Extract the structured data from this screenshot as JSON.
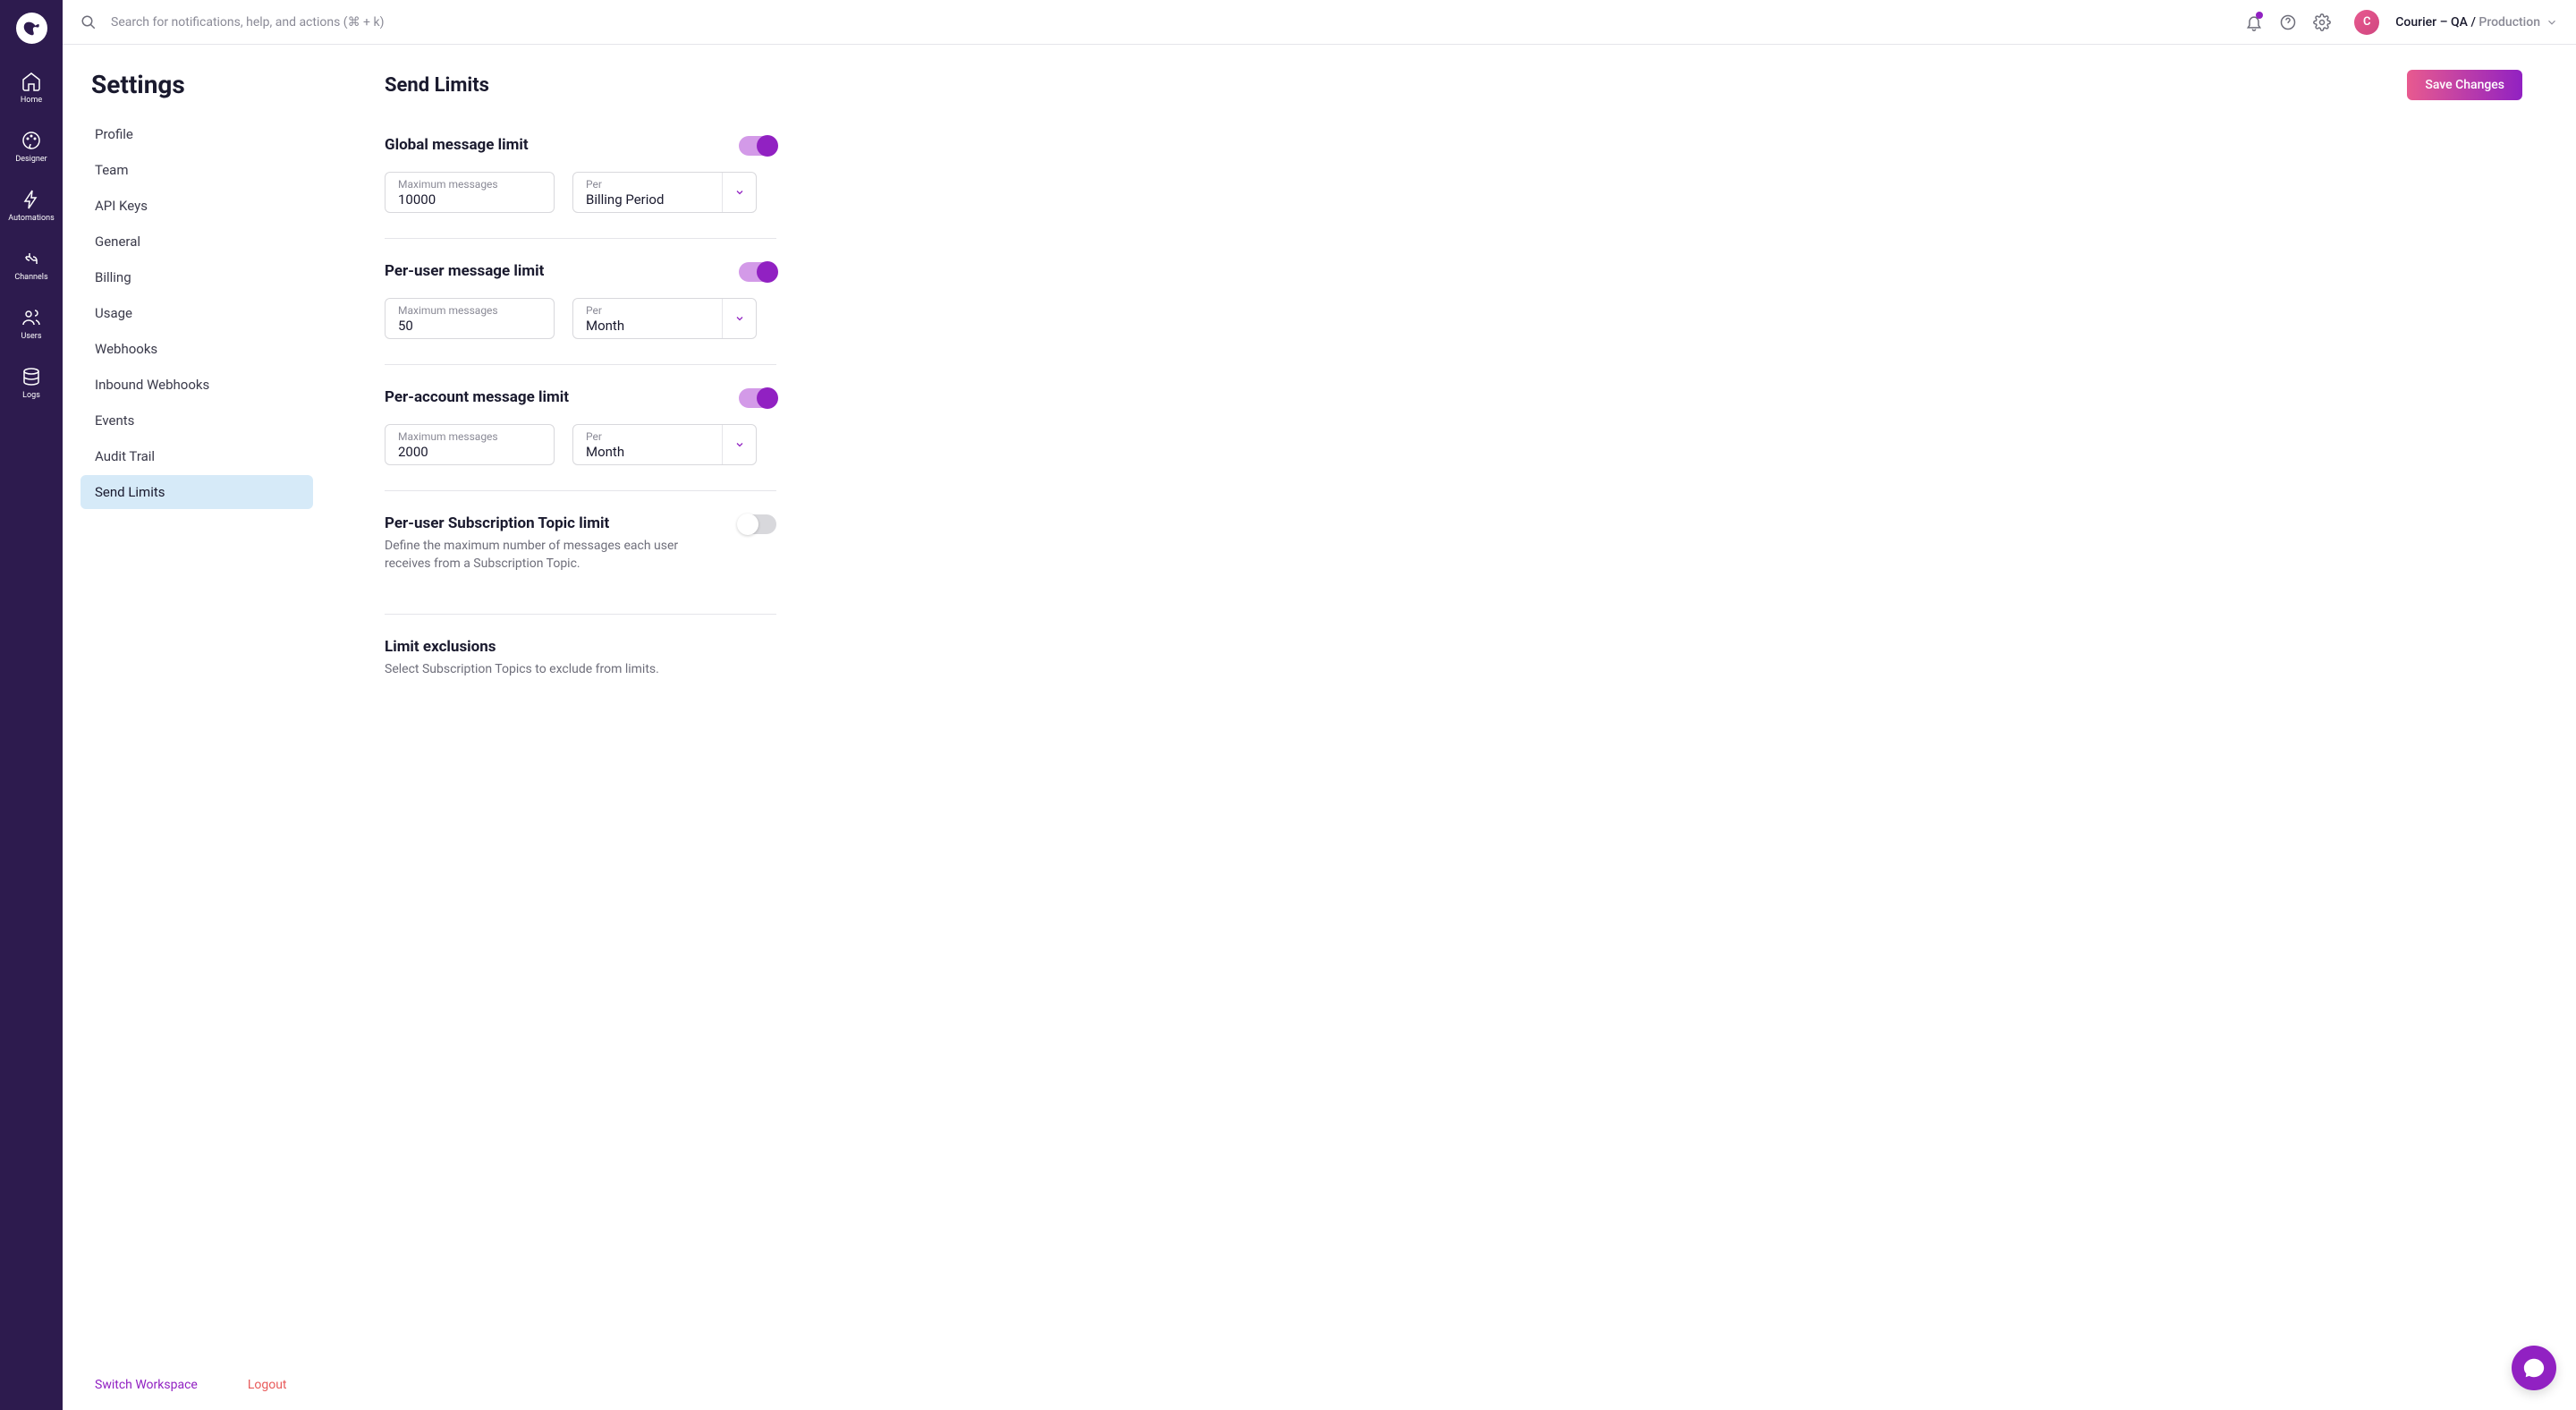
{
  "nav": {
    "items": [
      {
        "label": "Home"
      },
      {
        "label": "Designer"
      },
      {
        "label": "Automations"
      },
      {
        "label": "Channels"
      },
      {
        "label": "Users"
      },
      {
        "label": "Logs"
      }
    ]
  },
  "header": {
    "search_placeholder": "Search for notifications, help, and actions (⌘ + k)",
    "avatar_initial": "C",
    "workspace_primary": "Courier – QA / ",
    "workspace_secondary": "Production"
  },
  "settings": {
    "title": "Settings",
    "nav": [
      {
        "label": "Profile"
      },
      {
        "label": "Team"
      },
      {
        "label": "API Keys"
      },
      {
        "label": "General"
      },
      {
        "label": "Billing"
      },
      {
        "label": "Usage"
      },
      {
        "label": "Webhooks"
      },
      {
        "label": "Inbound Webhooks"
      },
      {
        "label": "Events"
      },
      {
        "label": "Audit Trail"
      },
      {
        "label": "Send Limits"
      }
    ],
    "active_index": 10,
    "footer": {
      "switch": "Switch Workspace",
      "logout": "Logout"
    }
  },
  "page": {
    "heading": "Send Limits",
    "save_button": "Save Changes",
    "sections": {
      "global": {
        "title": "Global message limit",
        "max_label": "Maximum messages",
        "max_value": "10000",
        "per_label": "Per",
        "per_value": "Billing Period",
        "enabled": true
      },
      "per_user": {
        "title": "Per-user message limit",
        "max_label": "Maximum messages",
        "max_value": "50",
        "per_label": "Per",
        "per_value": "Month",
        "enabled": true
      },
      "per_account": {
        "title": "Per-account message limit",
        "max_label": "Maximum messages",
        "max_value": "2000",
        "per_label": "Per",
        "per_value": "Month",
        "enabled": true
      },
      "subscription": {
        "title": "Per-user Subscription Topic limit",
        "desc": "Define the maximum number of messages each user receives from a Subscription Topic.",
        "enabled": false
      },
      "exclusions": {
        "title": "Limit exclusions",
        "desc": "Select Subscription Topics to exclude from limits."
      }
    }
  }
}
